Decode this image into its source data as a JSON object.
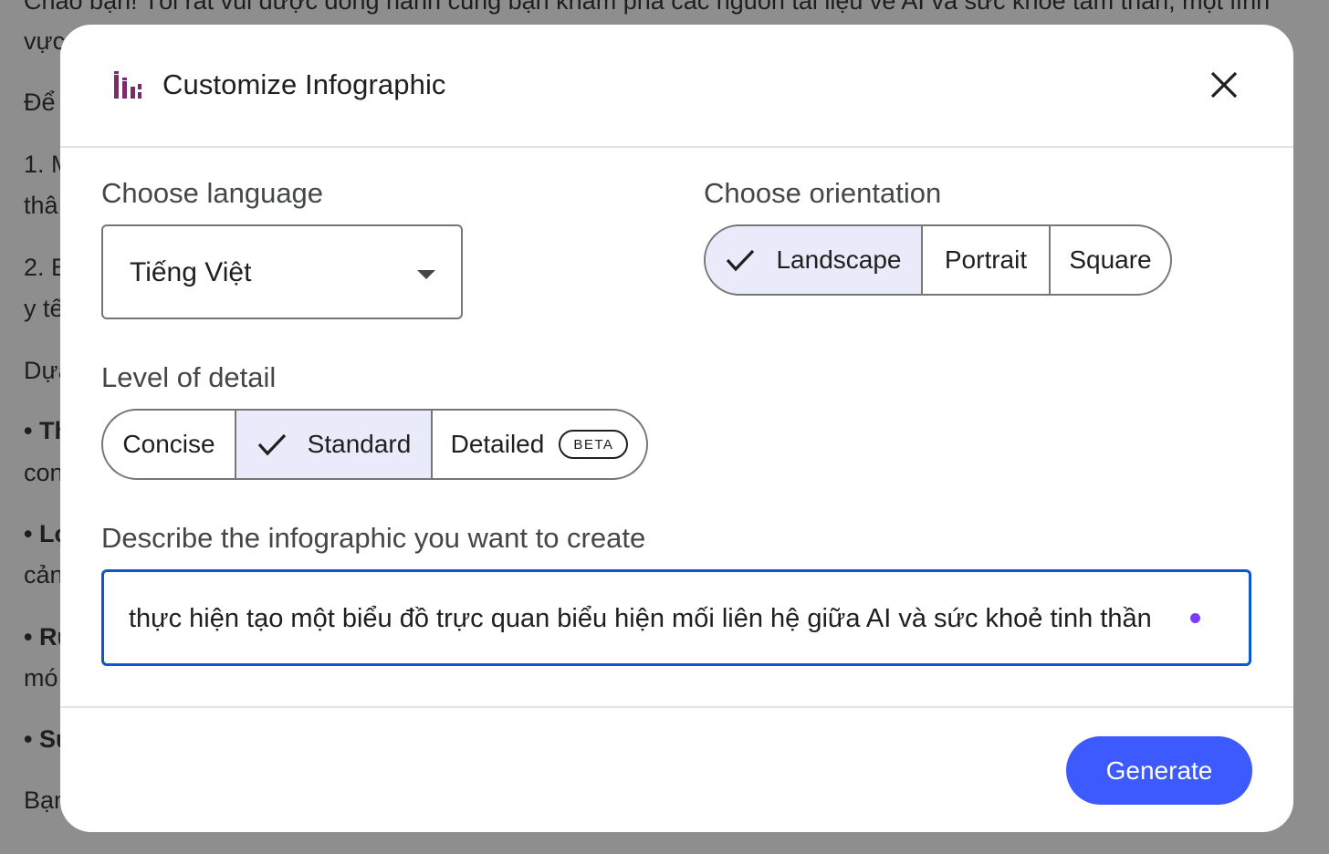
{
  "background": {
    "top_line": "Chào bạn! Tôi rất vui được đồng hành cùng bạn khám phá các nguồn tài liệu về AI và sức khỏe tâm thần, một lĩnh",
    "lines": [
      "vực",
      "Để",
      "1. M",
      "thâ",
      "2. B",
      "y tế",
      "Dựa",
      "• Th",
      "con",
      "• Lợ",
      "cản",
      "• Rủ",
      "mó",
      "• Sự",
      "Bạn"
    ]
  },
  "dialog": {
    "title": "Customize Infographic",
    "header_icon": "bar-chart-icon",
    "close_icon": "close-icon"
  },
  "language": {
    "label": "Choose language",
    "selected": "Tiếng Việt"
  },
  "orientation": {
    "label": "Choose orientation",
    "options": [
      "Landscape",
      "Portrait",
      "Square"
    ],
    "selected": "Landscape"
  },
  "detail": {
    "label": "Level of detail",
    "options": [
      "Concise",
      "Standard",
      "Detailed"
    ],
    "selected": "Standard",
    "beta_badge": "BETA"
  },
  "description": {
    "label": "Describe the infographic you want to create",
    "value": "thực hiện tạo một biểu đồ trực quan biểu hiện mối liên hệ giữa AI và sức khoẻ tinh thần"
  },
  "footer": {
    "generate_label": "Generate"
  },
  "colors": {
    "accent": "#3d5afe",
    "focus_border": "#0b57d0",
    "selected_segment": "#e9eafa",
    "icon_purple": "#7b2a6b"
  }
}
